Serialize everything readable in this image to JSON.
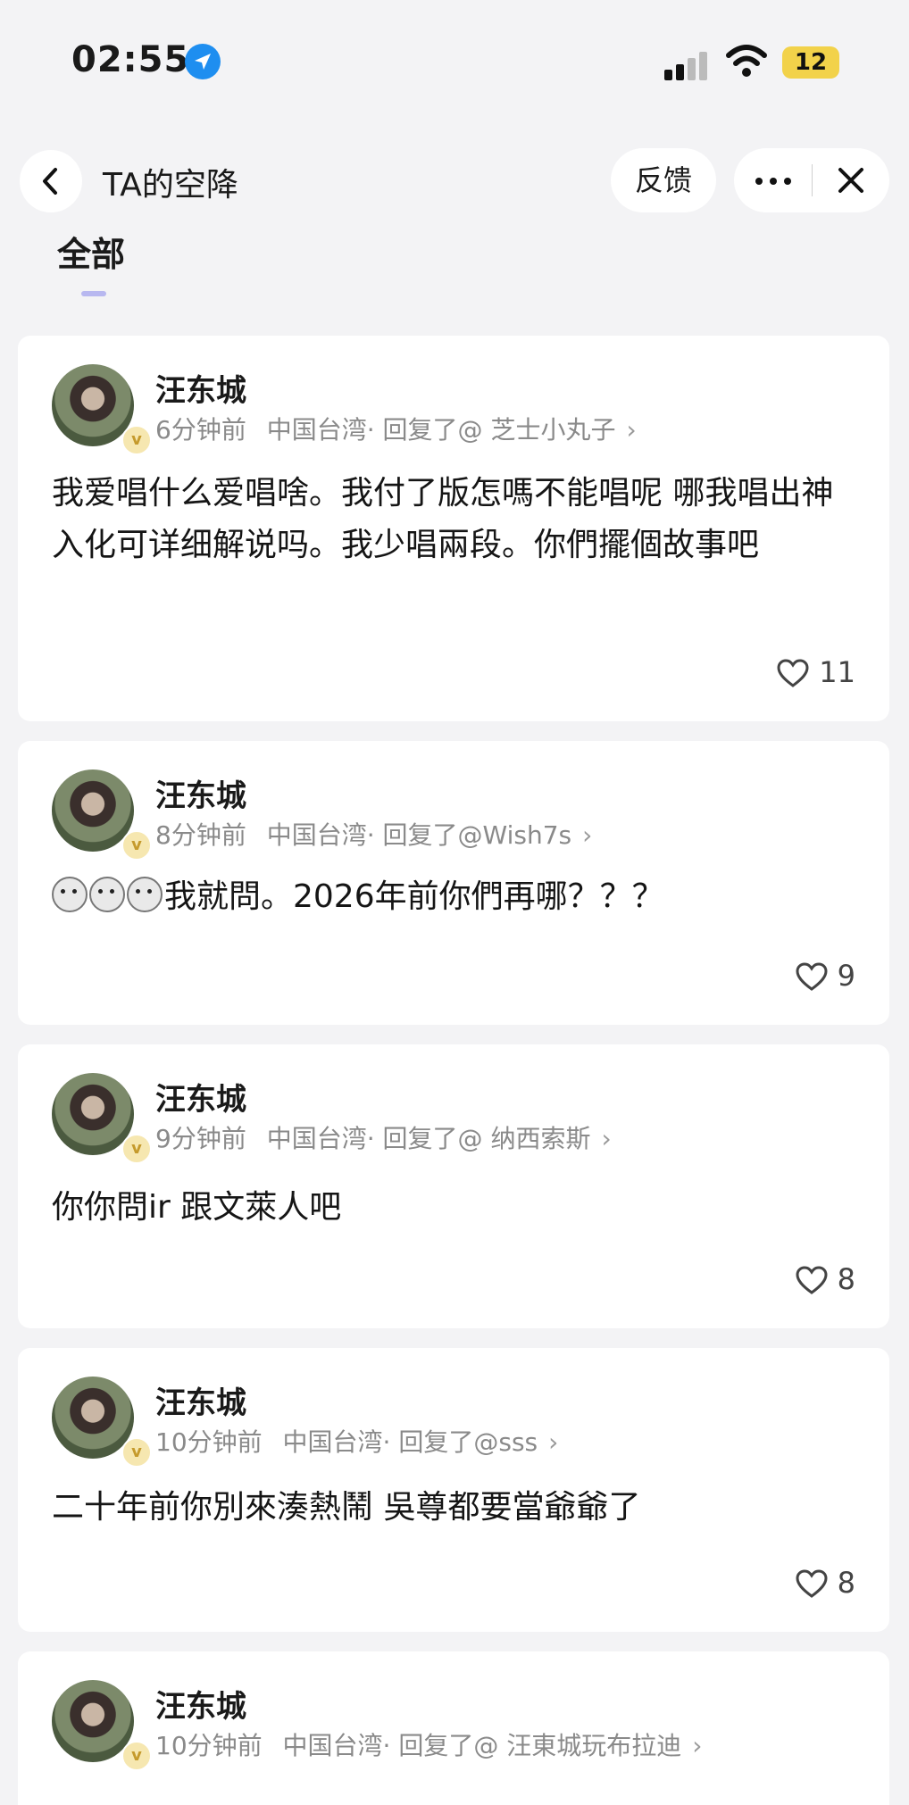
{
  "status_bar": {
    "time": "02:55",
    "battery": "12"
  },
  "header": {
    "title": "TA的空降",
    "feedback": "反馈"
  },
  "tabs": [
    {
      "label": "全部",
      "active": true
    }
  ],
  "posts": [
    {
      "name": "汪东城",
      "time": "6分钟前",
      "location": "中国台湾·",
      "reply": "回复了@ 芝士小丸子",
      "text": "我爱唱什么爱唱啥。我付了版怎嗎不能唱呢 哪我唱出神入化可详细解说吗。我少唱兩段。你們擺個故事吧",
      "likes": "11"
    },
    {
      "name": "汪东城",
      "time": "8分钟前",
      "location": "中国台湾·",
      "reply": "回复了@Wish7s",
      "text": "我就問。2026年前你們再哪？？？",
      "likes": "9"
    },
    {
      "name": "汪东城",
      "time": "9分钟前",
      "location": "中国台湾·",
      "reply": "回复了@ 纳西索斯",
      "text": "你你問ir 跟文萊人吧",
      "likes": "8"
    },
    {
      "name": "汪东城",
      "time": "10分钟前",
      "location": "中国台湾·",
      "reply": "回复了@sss",
      "text": "二十年前你別來湊熱鬧 吳尊都要當爺爺了",
      "likes": "8"
    },
    {
      "name": "汪东城",
      "time": "10分钟前",
      "location": "中国台湾·",
      "reply": "回复了@ 汪東城玩布拉迪",
      "text": "",
      "likes": ""
    }
  ],
  "colors": {
    "background": "#f3f3f5",
    "card": "#ffffff",
    "meta_gray": "#8a8a8a",
    "location_blue": "#1e8ef0",
    "battery": "#f2d24a"
  }
}
